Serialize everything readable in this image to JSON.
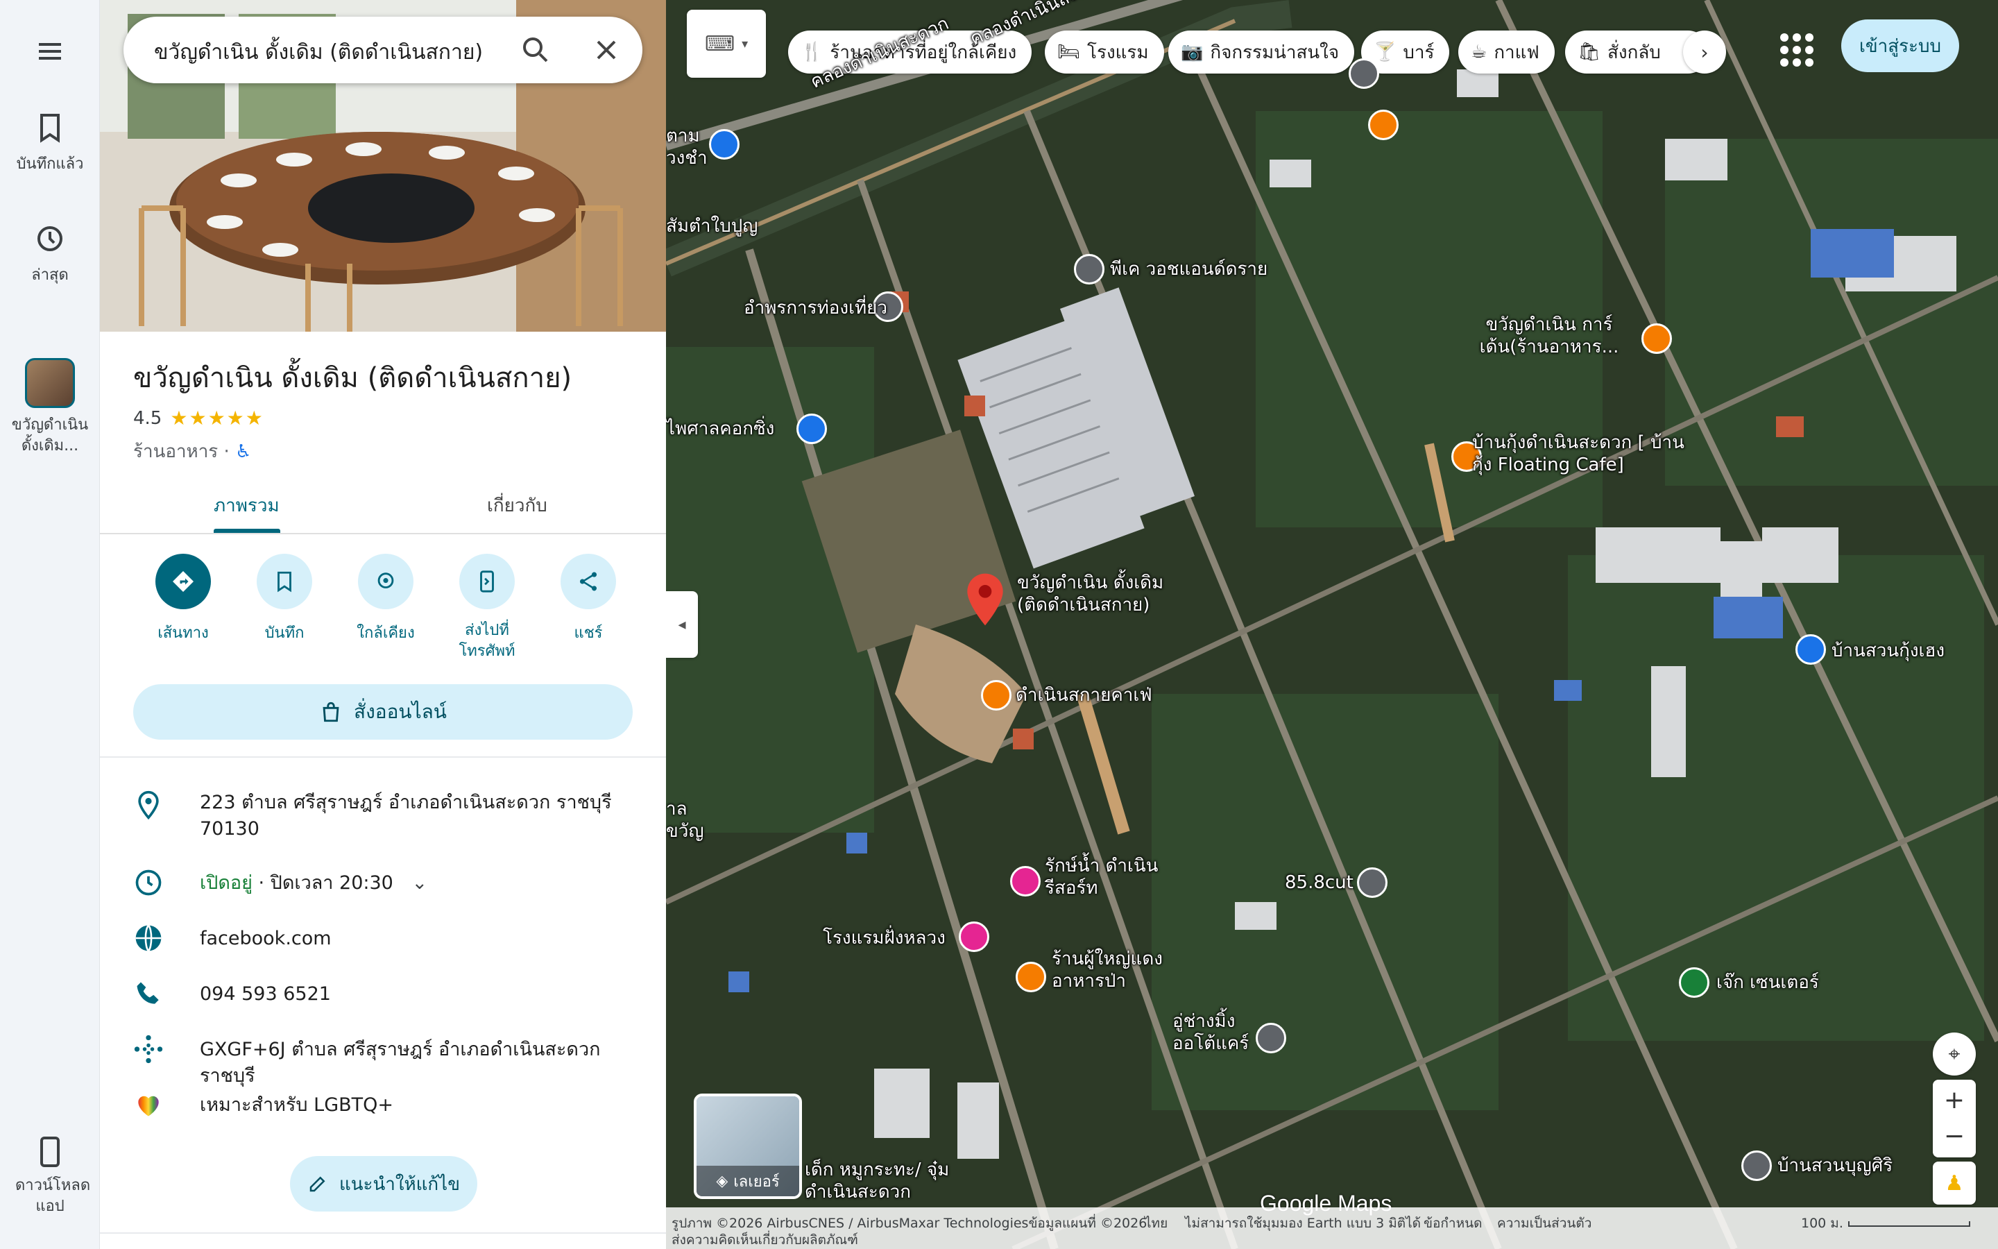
{
  "rail": {
    "menu_icon": "menu-icon",
    "saved_label": "บันทึกแล้ว",
    "recent_label": "ล่าสุด",
    "place_label": "ขวัญดำเนิน ดั้งเดิม...",
    "download_label": "ดาวน์โหลด แอป"
  },
  "search": {
    "query": "ขวัญดำเนิน ดั้งเดิม (ติดดำเนินสกาย)"
  },
  "place": {
    "name": "ขวัญดำเนิน ดั้งเดิม (ติดดำเนินสกาย)",
    "rating": "4.5",
    "stars": "★★★★★",
    "category": "ร้านอาหาร ·",
    "tabs": [
      "ภาพรวม",
      "เกี่ยวกับ"
    ],
    "actions": [
      "เส้นทาง",
      "บันทึก",
      "ใกล้เคียง",
      "ส่งไปที่โทรศัพท์",
      "แชร์"
    ],
    "order_label": "สั่งออนไลน์",
    "address": "223 ตำบล ศรีสุราษฎร์ อำเภอดำเนินสะดวก ราชบุรี 70130",
    "hours_open": "เปิดอยู่",
    "hours_close": " · ปิดเวลา 20:30",
    "website": "facebook.com",
    "phone": "094 593 6521",
    "plus_code": "GXGF+6J ตำบล ศรีสุราษฎร์ อำเภอดำเนินสะดวก ราชบุรี",
    "lgbtq": "เหมาะสำหรับ LGBTQ+",
    "suggest_edit": "แนะนำให้แก้ไข"
  },
  "map": {
    "chips": [
      "ร้านอาหารที่อยู่ใกล้เคียง",
      "โรงแรม",
      "กิจกรรมน่าสนใจ",
      "บาร์",
      "กาแฟ",
      "สั่งกลับ"
    ],
    "signin": "เข้าสู่ระบบ",
    "layers": "เลเยอร์",
    "labels": {
      "pk_watch": "พีเค วอชแอนด์ดราย",
      "amphon": "อำพรการท่องเที่ยว",
      "sam_tambon": "สัมตำใบปูญ",
      "phaisarn": "ไพศาลคอกซิ่ง",
      "kwan_garden": "ขวัญดำเนิน การ์เด้น(ร้านอาหาร...",
      "ban_kung": "บ้านกุ้งดำเนินสะดวก [ บ้านกุ้ง Floating Cafe]",
      "main_place": "ขวัญดำเนิน ดั้งเดิม (ติดดำเนินสกาย)",
      "cafe": "ดำเนินสกายคาเฟ่",
      "ban_suan_kung": "บ้านสวนกุ้งเฮง",
      "rak_nam": "รักษ์น้ำ ดำเนิน รีสอร์ท",
      "hotel": "โรงแรมฝั่งหลวง",
      "restaurant_yai": "ร้านผู้ใหญ่แดง อาหารป่า",
      "cut": "85.8cut",
      "jek_center": "เจ๊ก เซนเตอร์",
      "auto_care": "อู่ช่างมิ้ง ออโต้แคร์",
      "ban_suan_boon": "บ้านสวนบุญศิริ",
      "klong1": "คลองดำเนินสะดวก",
      "klong2": "คลองดำเนินสะดวก",
      "school": "เด็ก หมูกระทะ/ จุ๋ม ดำเนินสะดวก",
      "ta": "ตาม วงชำ",
      "kwan_left": "าล ขวัญ"
    },
    "footer": {
      "imagery": "รูปภาพ ©2026 AirbusCNES / AirbusMaxar Technologiesข้อมูลแผนที่ ©2026",
      "lang": "ไทย",
      "earth": "ไม่สามารถใช้มุมมอง Earth แบบ 3 มิติได้",
      "terms": "ข้อกำหนด",
      "privacy": "ความเป็นส่วนตัว",
      "feedback": "ส่งความคิดเห็นเกี่ยวกับผลิตภัณฑ์",
      "scale": "100 ม."
    },
    "brand": "Google Maps"
  }
}
